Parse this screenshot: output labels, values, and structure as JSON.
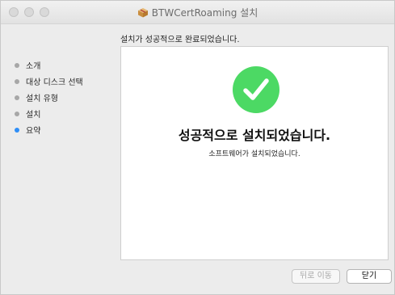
{
  "window": {
    "title": "BTWCertRoaming 설치",
    "title_icon": "package-icon"
  },
  "subtitle": "설치가 성공적으로 완료되었습니다.",
  "sidebar": {
    "steps": [
      {
        "label": "소개",
        "active": false
      },
      {
        "label": "대상 디스크 선택",
        "active": false
      },
      {
        "label": "설치 유형",
        "active": false
      },
      {
        "label": "설치",
        "active": false
      },
      {
        "label": "요약",
        "active": true
      }
    ]
  },
  "main": {
    "success_icon": "checkmark-circle-icon",
    "headline": "성공적으로 설치되었습니다.",
    "description": "소프트웨어가 설치되었습니다."
  },
  "buttons": {
    "back_label": "뒤로 이동",
    "close_label": "닫기"
  },
  "colors": {
    "success_green": "#4cd964",
    "active_step": "#2f8ef7",
    "inactive_step": "#a7a7a7"
  }
}
